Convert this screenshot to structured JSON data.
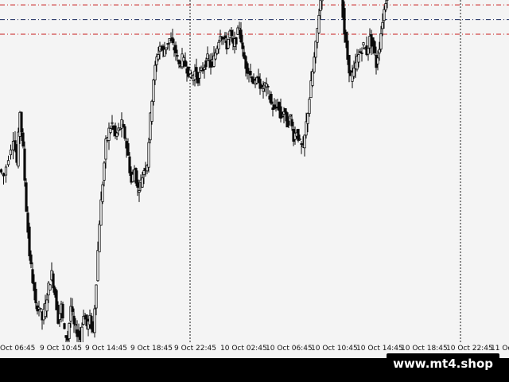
{
  "chart_data": {
    "type": "candlestick",
    "title": "",
    "xlabel": "",
    "ylabel": "",
    "grid": false,
    "time_labels": [
      "Oct 06:45",
      "9 Oct 10:45",
      "9 Oct 14:45",
      "9 Oct 18:45",
      "9 Oct 22:45",
      "10 Oct 02:45",
      "10 Oct 06:45",
      "10 Oct 10:45",
      "10 Oct 14:45",
      "10 Oct 18:45",
      "10 Oct 22:45",
      "11 Oc"
    ],
    "vertical_markers": [
      "9 Oct 22:45",
      "10 Oct 22:45"
    ],
    "horizontal_levels": [
      {
        "value": 172.5,
        "style": "dash-dot",
        "color": "#c81e1e"
      },
      {
        "value": 168.0,
        "style": "dash-dot",
        "color": "#1a2a5e"
      },
      {
        "value": 163.5,
        "style": "dash-dot",
        "color": "#c81e1e"
      }
    ],
    "y_range": [
      69,
      174
    ],
    "close_path": [
      [
        0,
        122
      ],
      [
        6,
        120
      ],
      [
        12,
        126
      ],
      [
        18,
        132
      ],
      [
        22,
        124
      ],
      [
        26,
        140
      ],
      [
        30,
        128
      ],
      [
        34,
        110
      ],
      [
        38,
        96
      ],
      [
        42,
        88
      ],
      [
        46,
        80
      ],
      [
        50,
        80
      ],
      [
        54,
        76
      ],
      [
        58,
        80
      ],
      [
        62,
        86
      ],
      [
        66,
        90
      ],
      [
        70,
        84
      ],
      [
        74,
        76
      ],
      [
        78,
        80
      ],
      [
        82,
        72
      ],
      [
        86,
        70
      ],
      [
        90,
        80
      ],
      [
        94,
        74
      ],
      [
        98,
        72
      ],
      [
        102,
        70
      ],
      [
        106,
        78
      ],
      [
        110,
        74
      ],
      [
        114,
        76
      ],
      [
        118,
        72
      ],
      [
        122,
        88
      ],
      [
        126,
        106
      ],
      [
        130,
        118
      ],
      [
        134,
        130
      ],
      [
        138,
        134
      ],
      [
        142,
        136
      ],
      [
        146,
        132
      ],
      [
        150,
        134
      ],
      [
        154,
        136
      ],
      [
        158,
        132
      ],
      [
        162,
        126
      ],
      [
        166,
        118
      ],
      [
        170,
        122
      ],
      [
        174,
        116
      ],
      [
        178,
        118
      ],
      [
        182,
        122
      ],
      [
        186,
        124
      ],
      [
        190,
        138
      ],
      [
        194,
        150
      ],
      [
        198,
        156
      ],
      [
        202,
        160
      ],
      [
        206,
        158
      ],
      [
        210,
        160
      ],
      [
        214,
        162
      ],
      [
        218,
        160
      ],
      [
        222,
        158
      ],
      [
        226,
        154
      ],
      [
        230,
        156
      ],
      [
        234,
        154
      ],
      [
        238,
        152
      ],
      [
        242,
        150
      ],
      [
        246,
        152
      ],
      [
        250,
        150
      ],
      [
        254,
        152
      ],
      [
        258,
        154
      ],
      [
        262,
        156
      ],
      [
        266,
        154
      ],
      [
        270,
        156
      ],
      [
        274,
        160
      ],
      [
        278,
        164
      ],
      [
        282,
        162
      ],
      [
        286,
        160
      ],
      [
        290,
        164
      ],
      [
        294,
        160
      ],
      [
        298,
        162
      ],
      [
        302,
        166
      ],
      [
        306,
        158
      ],
      [
        310,
        154
      ],
      [
        314,
        152
      ],
      [
        318,
        150
      ],
      [
        322,
        148
      ],
      [
        326,
        150
      ],
      [
        330,
        146
      ],
      [
        334,
        148
      ],
      [
        338,
        146
      ],
      [
        342,
        142
      ],
      [
        346,
        140
      ],
      [
        350,
        142
      ],
      [
        354,
        138
      ],
      [
        358,
        140
      ],
      [
        362,
        136
      ],
      [
        366,
        138
      ],
      [
        370,
        132
      ],
      [
        374,
        134
      ],
      [
        378,
        130
      ],
      [
        382,
        128
      ],
      [
        386,
        136
      ],
      [
        390,
        144
      ],
      [
        394,
        152
      ],
      [
        398,
        160
      ],
      [
        402,
        170
      ],
      [
        406,
        178
      ],
      [
        410,
        186
      ],
      [
        414,
        184
      ],
      [
        418,
        180
      ],
      [
        422,
        182
      ],
      [
        426,
        178
      ],
      [
        430,
        176
      ],
      [
        434,
        164
      ],
      [
        438,
        156
      ],
      [
        442,
        150
      ],
      [
        446,
        152
      ],
      [
        450,
        156
      ],
      [
        454,
        158
      ],
      [
        458,
        160
      ],
      [
        462,
        158
      ],
      [
        466,
        162
      ],
      [
        470,
        160
      ],
      [
        474,
        154
      ],
      [
        478,
        160
      ],
      [
        482,
        168
      ],
      [
        486,
        174
      ],
      [
        490,
        178
      ],
      [
        494,
        182
      ],
      [
        498,
        188
      ],
      [
        502,
        194
      ],
      [
        506,
        200
      ],
      [
        510,
        196
      ],
      [
        514,
        202
      ],
      [
        518,
        198
      ],
      [
        522,
        196
      ],
      [
        526,
        186
      ],
      [
        530,
        184
      ],
      [
        534,
        188
      ],
      [
        538,
        186
      ],
      [
        542,
        190
      ],
      [
        546,
        192
      ],
      [
        550,
        196
      ],
      [
        554,
        194
      ],
      [
        558,
        198
      ],
      [
        562,
        200
      ],
      [
        566,
        202
      ],
      [
        570,
        200
      ],
      [
        574,
        198
      ],
      [
        578,
        196
      ],
      [
        582,
        192
      ],
      [
        586,
        194
      ],
      [
        590,
        196
      ],
      [
        594,
        198
      ],
      [
        598,
        202
      ],
      [
        602,
        204
      ],
      [
        606,
        206
      ],
      [
        610,
        210
      ],
      [
        614,
        208
      ],
      [
        618,
        212
      ],
      [
        622,
        214
      ],
      [
        626,
        216
      ],
      [
        630,
        216
      ],
      [
        634,
        214
      ],
      [
        638,
        208
      ]
    ]
  },
  "watermark": {
    "text": "www.mt4.shop"
  },
  "colors": {
    "background": "#f4f4f4",
    "candle": "#0a0a0a",
    "marker_line": "#1a1a1a",
    "level_red": "#c81e1e",
    "level_navy": "#1a2a5e",
    "footer": "#000000"
  }
}
